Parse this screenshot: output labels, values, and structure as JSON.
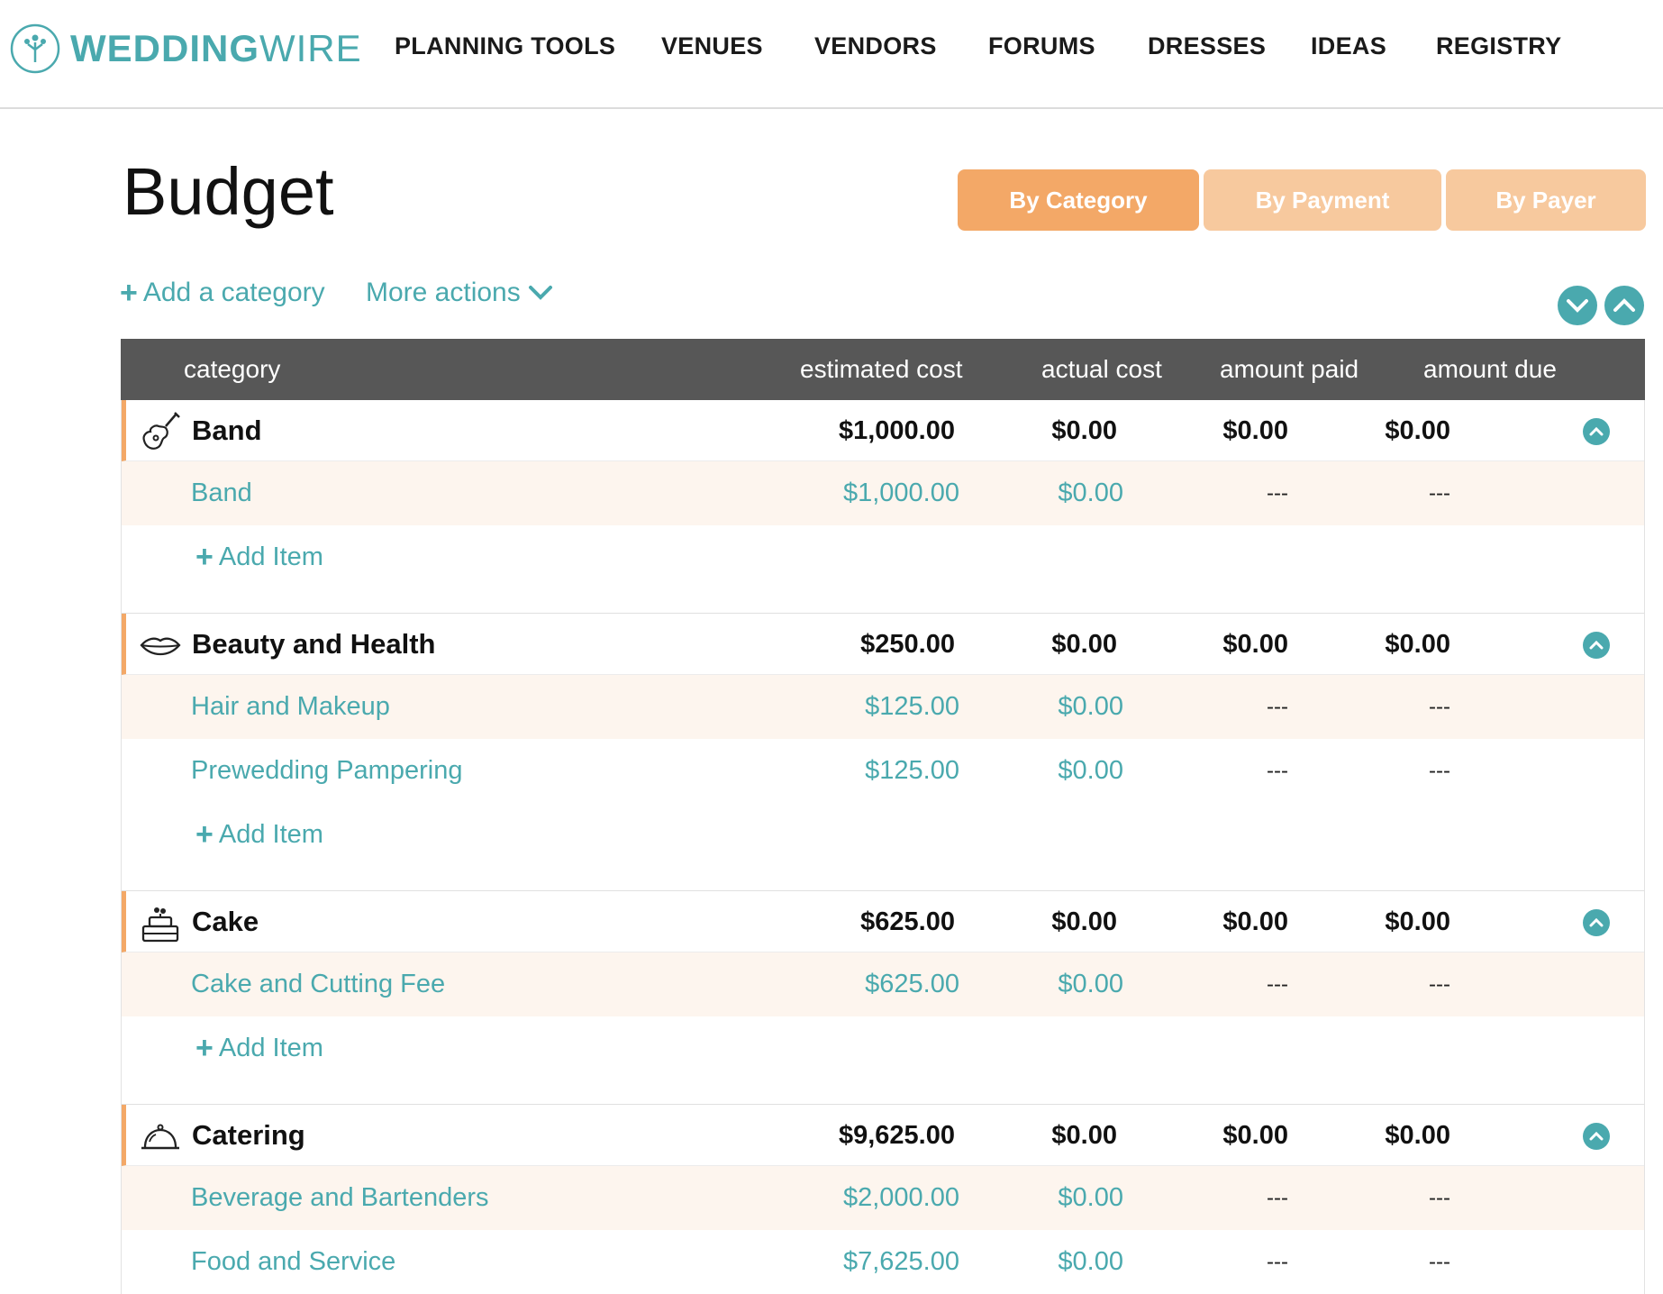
{
  "brand": {
    "name_part1": "WEDDING",
    "name_part2": "WIRE",
    "color": "#4aa9ae"
  },
  "nav": [
    {
      "label": "PLANNING TOOLS"
    },
    {
      "label": "VENUES"
    },
    {
      "label": "VENDORS"
    },
    {
      "label": "FORUMS"
    },
    {
      "label": "DRESSES"
    },
    {
      "label": "IDEAS"
    },
    {
      "label": "REGISTRY"
    }
  ],
  "page": {
    "title": "Budget"
  },
  "view_tabs": [
    {
      "label": "By Category",
      "active": true,
      "color": "#f3a867"
    },
    {
      "label": "By Payment",
      "active": false,
      "color": "#f7c99e"
    },
    {
      "label": "By Payer",
      "active": false,
      "color": "#f7c99e"
    }
  ],
  "actions": {
    "add_category": "Add a category",
    "more_actions": "More actions"
  },
  "table": {
    "headers": {
      "category": "category",
      "estimated": "estimated cost",
      "actual": "actual cost",
      "paid": "amount paid",
      "due": "amount due"
    },
    "add_item_label": "Add Item",
    "categories": [
      {
        "name": "Band",
        "icon": "guitar-icon",
        "estimated": "$1,000.00",
        "actual": "$0.00",
        "paid": "$0.00",
        "due": "$0.00",
        "items": [
          {
            "name": "Band",
            "estimated": "$1,000.00",
            "actual": "$0.00",
            "paid": "---",
            "due": "---"
          }
        ]
      },
      {
        "name": "Beauty and Health",
        "icon": "lips-icon",
        "estimated": "$250.00",
        "actual": "$0.00",
        "paid": "$0.00",
        "due": "$0.00",
        "items": [
          {
            "name": "Hair and Makeup",
            "estimated": "$125.00",
            "actual": "$0.00",
            "paid": "---",
            "due": "---"
          },
          {
            "name": "Prewedding Pampering",
            "estimated": "$125.00",
            "actual": "$0.00",
            "paid": "---",
            "due": "---"
          }
        ]
      },
      {
        "name": "Cake",
        "icon": "cake-icon",
        "estimated": "$625.00",
        "actual": "$0.00",
        "paid": "$0.00",
        "due": "$0.00",
        "items": [
          {
            "name": "Cake and Cutting Fee",
            "estimated": "$625.00",
            "actual": "$0.00",
            "paid": "---",
            "due": "---"
          }
        ]
      },
      {
        "name": "Catering",
        "icon": "cloche-icon",
        "estimated": "$9,625.00",
        "actual": "$0.00",
        "paid": "$0.00",
        "due": "$0.00",
        "items": [
          {
            "name": "Beverage and Bartenders",
            "estimated": "$2,000.00",
            "actual": "$0.00",
            "paid": "---",
            "due": "---"
          },
          {
            "name": "Food and Service",
            "estimated": "$7,625.00",
            "actual": "$0.00",
            "paid": "---",
            "due": "---"
          }
        ]
      }
    ]
  }
}
